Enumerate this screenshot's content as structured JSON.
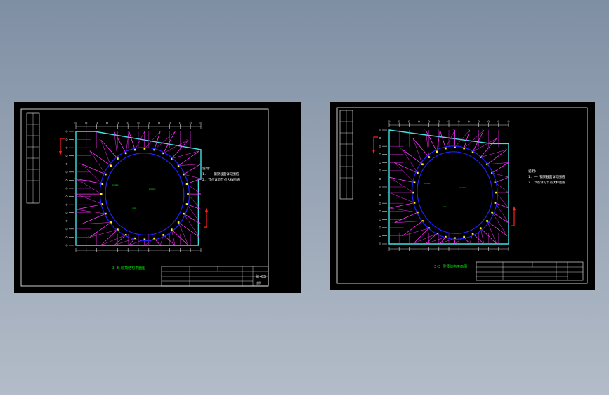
{
  "viewer": {
    "background_top": "#7f8fa3",
    "background_bottom": "#b3bcc8"
  },
  "drawings": [
    {
      "id": "left",
      "plan_title": "3-3 层顶结构平面图",
      "legend_line1": "说明:",
      "legend_line2": "1. ── 钢梁截面详见图纸",
      "legend_line3": "2. 节点详见节点大样图纸",
      "title_block": {
        "sheet_label": "结-03",
        "sheet_sub": "比例"
      }
    },
    {
      "id": "right",
      "plan_title": "3-3 层顶结构平面图",
      "legend_line1": "说明:",
      "legend_line2": "1. ── 钢梁截面详见图纸",
      "legend_line3": "2. 节点详见节点大样图纸",
      "title_block": {
        "sheet_label": "",
        "sheet_sub": ""
      }
    }
  ],
  "colors": {
    "sheet": "#000000",
    "border": "#ffffff",
    "beam": "#ff30ff",
    "edge": "#40e0e0",
    "ellipse": "#2020ff",
    "annotation": "#00ff00",
    "node": "#ffff00",
    "arrow": "#ff2020"
  }
}
